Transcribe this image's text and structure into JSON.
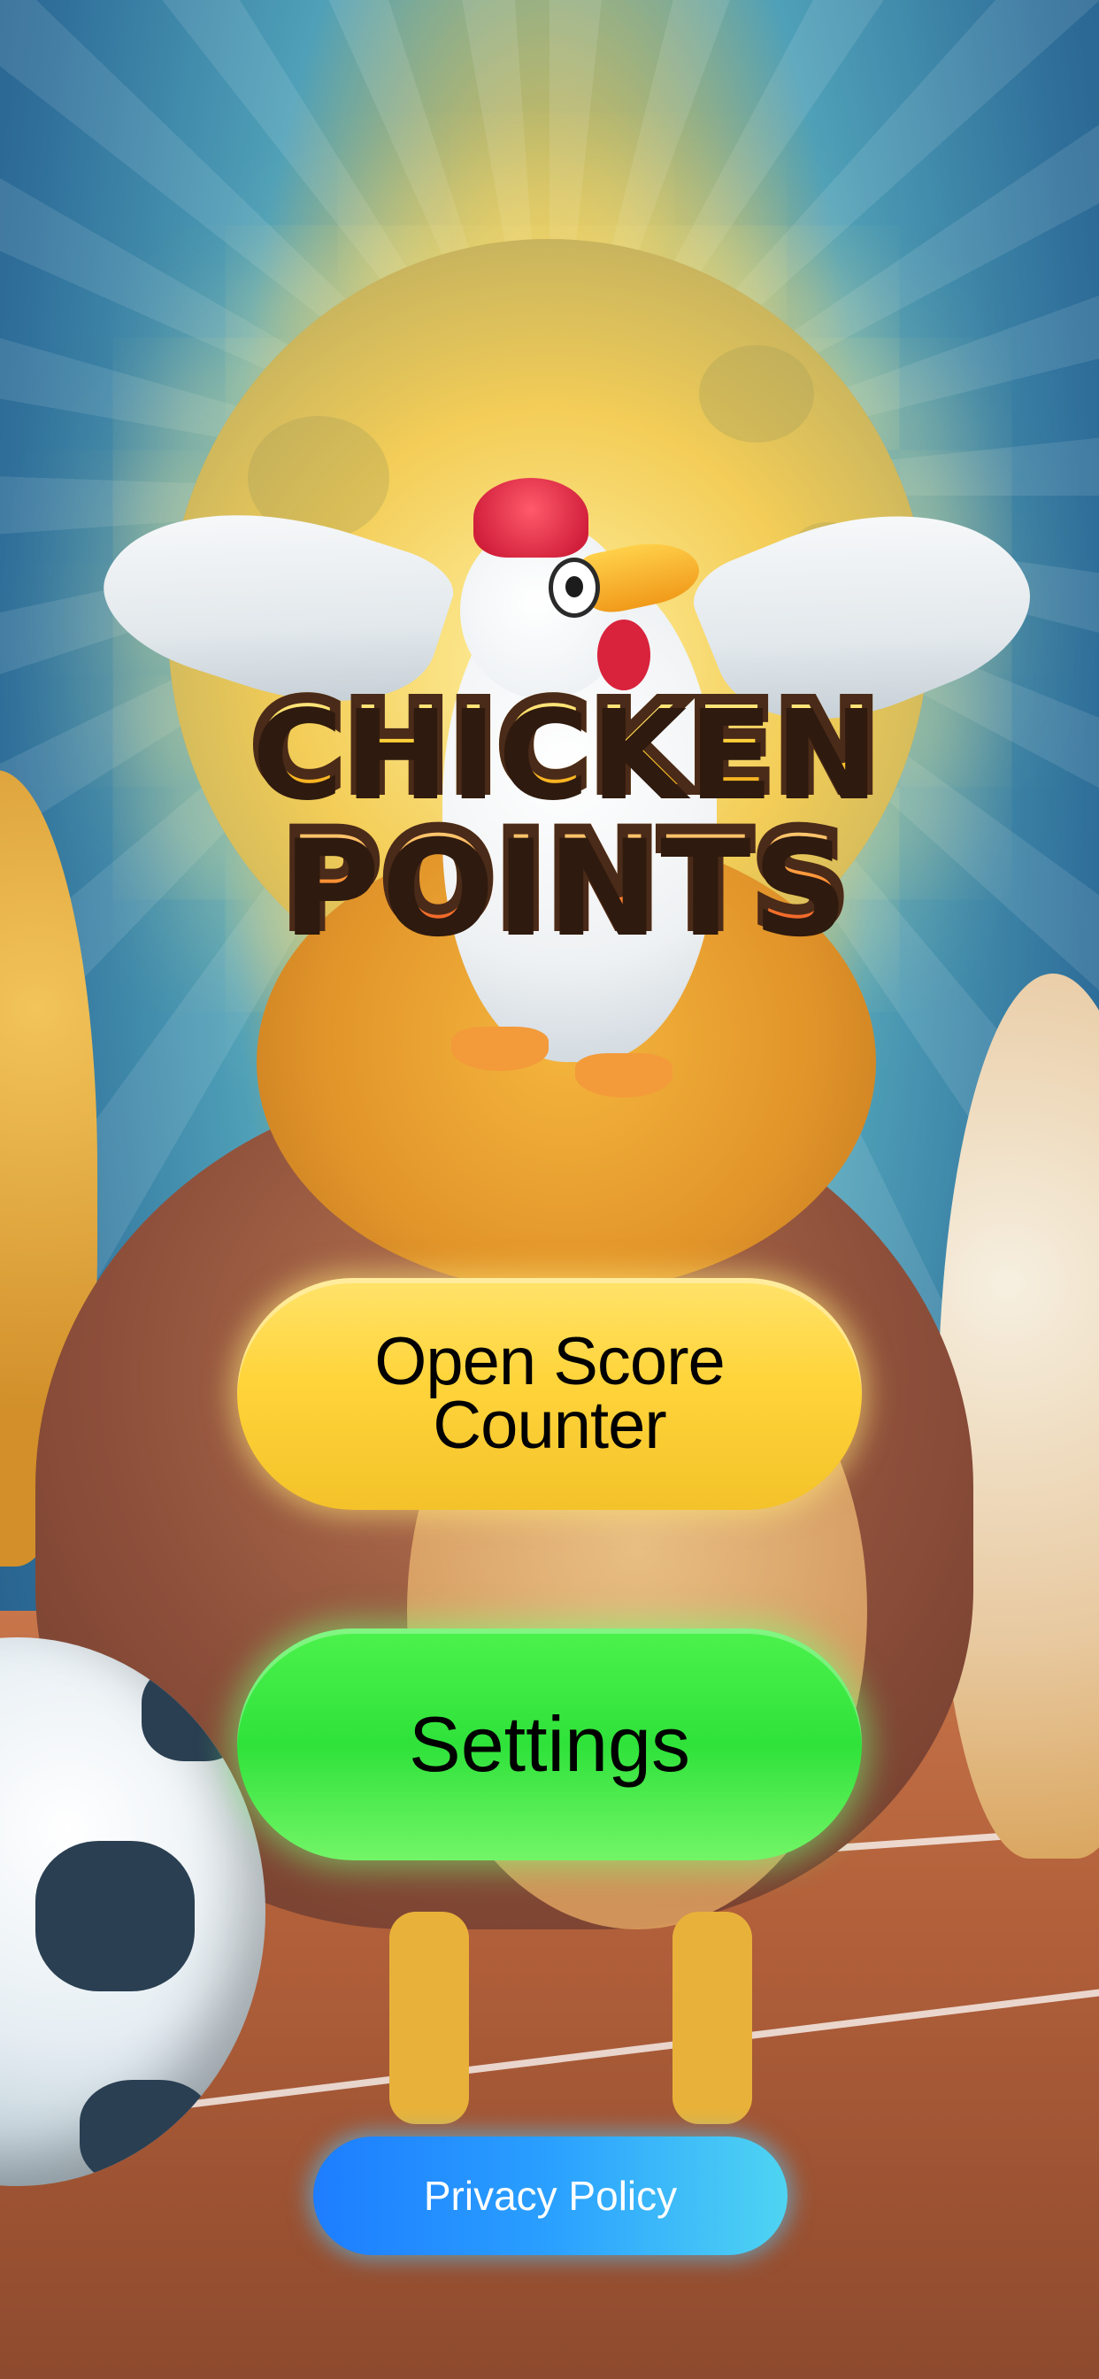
{
  "app": {
    "logo_line1": "CHICKEN",
    "logo_line2": "POINTS"
  },
  "menu": {
    "score_button_label_line1": "Open Score",
    "score_button_label_line2": "Counter",
    "settings_button_label": "Settings",
    "privacy_button_label": "Privacy Policy"
  },
  "colors": {
    "score_button": "#ffd43a",
    "settings_button": "#2fe23a",
    "privacy_button": "#2aa0ff"
  },
  "icons": {
    "mascot": "chicken-mascot-icon",
    "ball": "soccer-ball-icon"
  }
}
